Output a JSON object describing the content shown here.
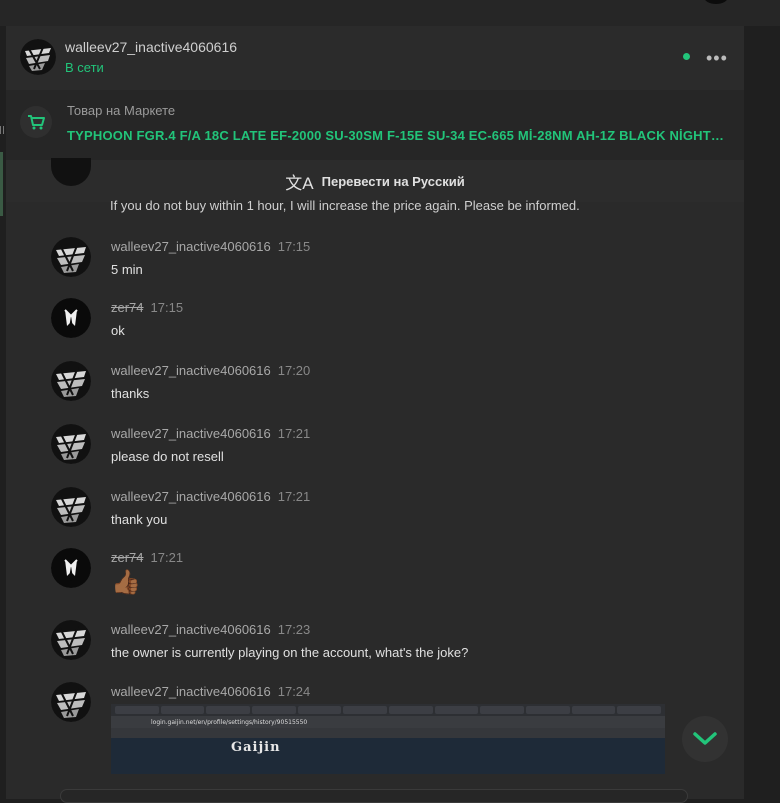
{
  "header": {
    "username": "walleev27_inactive4060616",
    "status": "В сети"
  },
  "market": {
    "label": "Товар на Маркете",
    "title": "TYPHOON FGR.4 F/A 18C LATE EF-2000 SU-30SM F-15E SU-34 EC-665 Mİ-28NM AH-1Z BLACK NİGHT LeOP..."
  },
  "translate": {
    "label": "Перевести на Русский"
  },
  "cut_message": "If you do not buy within 1 hour, I will increase the price again. Please be informed.",
  "messages": [
    {
      "name": "walleev27_inactive4060616",
      "time": "17:15",
      "text": "5 min"
    },
    {
      "name": "zer74",
      "time": "17:15",
      "text": "ok"
    },
    {
      "name": "walleev27_inactive4060616",
      "time": "17:20",
      "text": "thanks"
    },
    {
      "name": "walleev27_inactive4060616",
      "time": "17:21",
      "text": "please do not resell"
    },
    {
      "name": "walleev27_inactive4060616",
      "time": "17:21",
      "text": "thank you"
    },
    {
      "name": "zer74",
      "time": "17:21",
      "text": "👍🏾"
    },
    {
      "name": "walleev27_inactive4060616",
      "time": "17:23",
      "text": "the owner is currently playing on the account, what's the joke?"
    },
    {
      "name": "walleev27_inactive4060616",
      "time": "17:24",
      "text": ""
    }
  ],
  "screenshot": {
    "url": "login.gaijin.net/en/profile/settings/history/90515550",
    "logo": "Gaijin"
  },
  "icons": {
    "more": "more-dots-icon",
    "cart": "cart-icon",
    "translate": "translate-icon",
    "scroll": "chevron-down-icon"
  },
  "colors": {
    "accent": "#22c47a",
    "background": "#2a2a2a"
  }
}
